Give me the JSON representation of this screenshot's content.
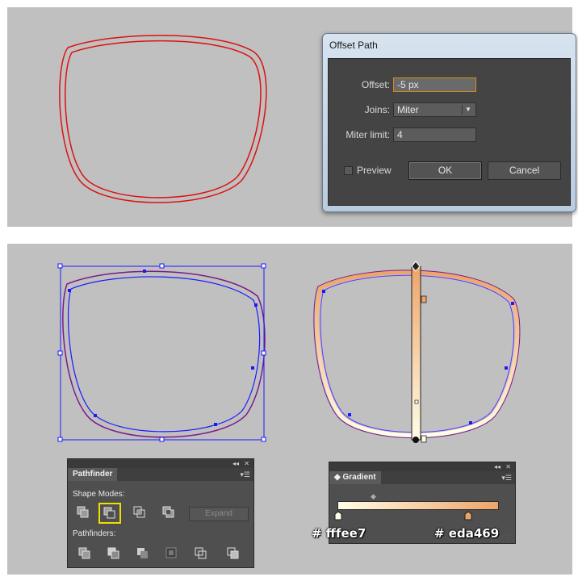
{
  "dialog": {
    "title": "Offset Path",
    "offset_label": "Offset:",
    "offset_value": "-5 px",
    "joins_label": "Joins:",
    "joins_value": "Miter",
    "miter_label": "Miter limit:",
    "miter_value": "4",
    "preview_label": "Preview",
    "preview_checked": false,
    "ok_label": "OK",
    "cancel_label": "Cancel"
  },
  "pathfinder": {
    "tab_label": "Pathfinder",
    "shape_modes_label": "Shape Modes:",
    "pathfinders_label": "Pathfinders:",
    "expand_label": "Expand",
    "topbar_collapse": "◂◂",
    "topbar_close": "✕",
    "shape_mode_icons": [
      "unite-icon",
      "minus-front-icon",
      "intersect-icon",
      "exclude-icon"
    ],
    "pathfinder_icons": [
      "divide-icon",
      "trim-icon",
      "merge-icon",
      "crop-icon",
      "outline-icon",
      "minus-back-icon"
    ],
    "highlighted_icon": "minus-front-icon"
  },
  "gradient": {
    "tab_label": "Gradient",
    "topbar_collapse": "◂◂",
    "topbar_close": "✕",
    "stop_left_hex": "# fffee7",
    "stop_right_hex": "# eda469",
    "colors": {
      "start": "#fffee7",
      "end": "#eda469"
    }
  },
  "colors": {
    "stroke_red": "#dd1111",
    "selection_blue": "#1a1aff",
    "canvas_gray": "#c0c0c0",
    "yellow_highlight": "#f0e000"
  }
}
